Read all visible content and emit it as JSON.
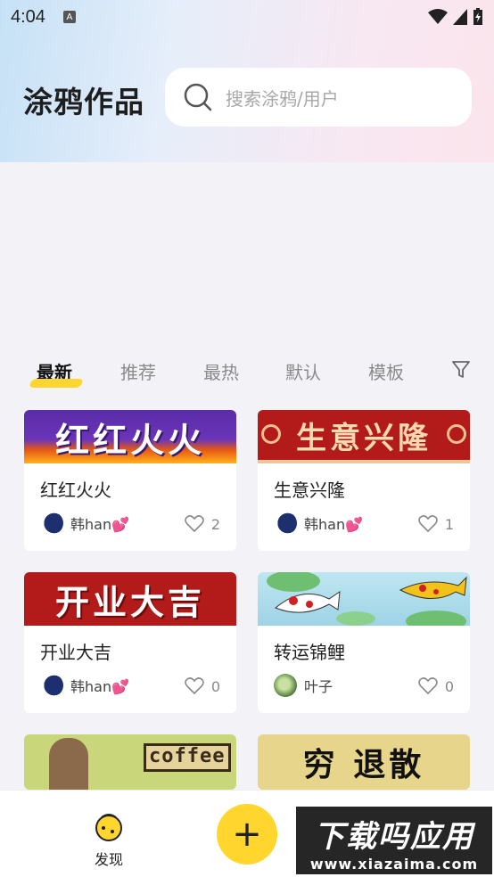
{
  "status_bar": {
    "time": "4:04",
    "notification_icon": "A"
  },
  "header": {
    "title": "涂鸦作品"
  },
  "search": {
    "placeholder": "搜索涂鸦/用户"
  },
  "tabs": [
    {
      "label": "最新",
      "active": true
    },
    {
      "label": "推荐",
      "active": false
    },
    {
      "label": "最热",
      "active": false
    },
    {
      "label": "默认",
      "active": false
    },
    {
      "label": "模板",
      "active": false
    }
  ],
  "cards": [
    {
      "image_text": "红红火火",
      "title": "红红火火",
      "author": "韩han💕",
      "likes": "2"
    },
    {
      "image_text": "生意兴隆",
      "title": "生意兴隆",
      "author": "韩han💕",
      "likes": "1"
    },
    {
      "image_text": "开业大吉",
      "title": "开业大吉",
      "author": "韩han💕",
      "likes": "0"
    },
    {
      "image_text": "",
      "title": "转运锦鲤",
      "author": "叶子",
      "likes": "0"
    },
    {
      "image_text": "coffee",
      "title": "",
      "author": "",
      "likes": ""
    },
    {
      "image_text": "穷 退散",
      "title": "",
      "author": "",
      "likes": ""
    }
  ],
  "bottom_nav": {
    "discover_label": "发现",
    "add_label": "+"
  },
  "watermark": {
    "line1": "下载吗应用",
    "line2": "www.xiazaima.com"
  },
  "colors": {
    "accent": "#ffd52e",
    "red_banner": "#b31a1a",
    "text_dark": "#222222"
  }
}
